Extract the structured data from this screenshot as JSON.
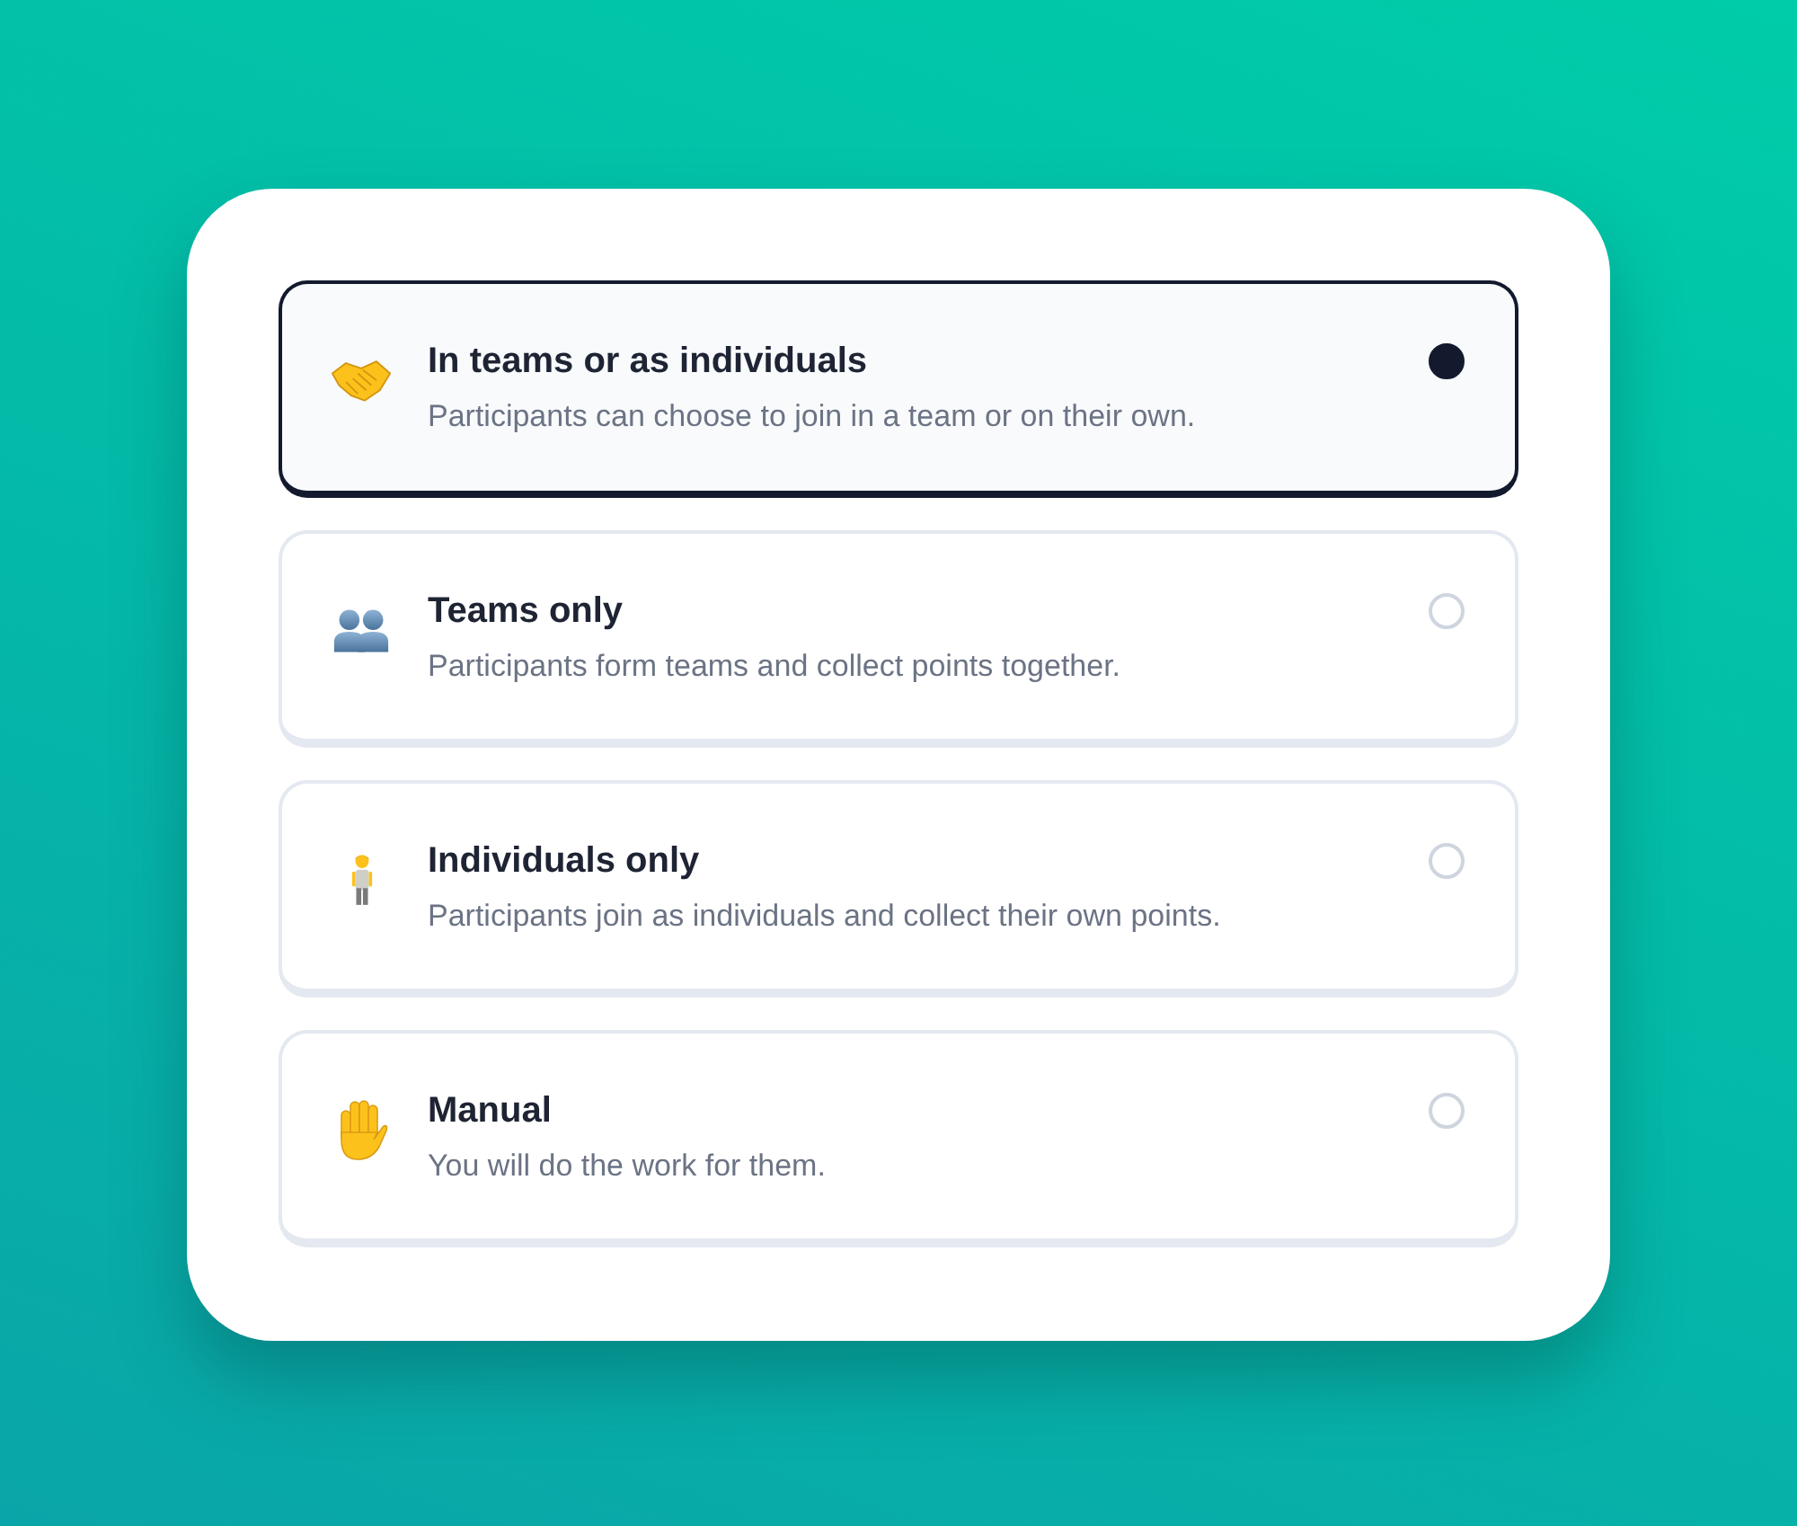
{
  "options": [
    {
      "title": "In teams or as individuals",
      "description": "Participants can choose to join in a team or on their own.",
      "selected": true
    },
    {
      "title": "Teams only",
      "description": "Participants form teams and collect points together.",
      "selected": false
    },
    {
      "title": "Individuals only",
      "description": "Participants join as individuals and collect their own points.",
      "selected": false
    },
    {
      "title": "Manual",
      "description": "You will do the work for them.",
      "selected": false
    }
  ]
}
